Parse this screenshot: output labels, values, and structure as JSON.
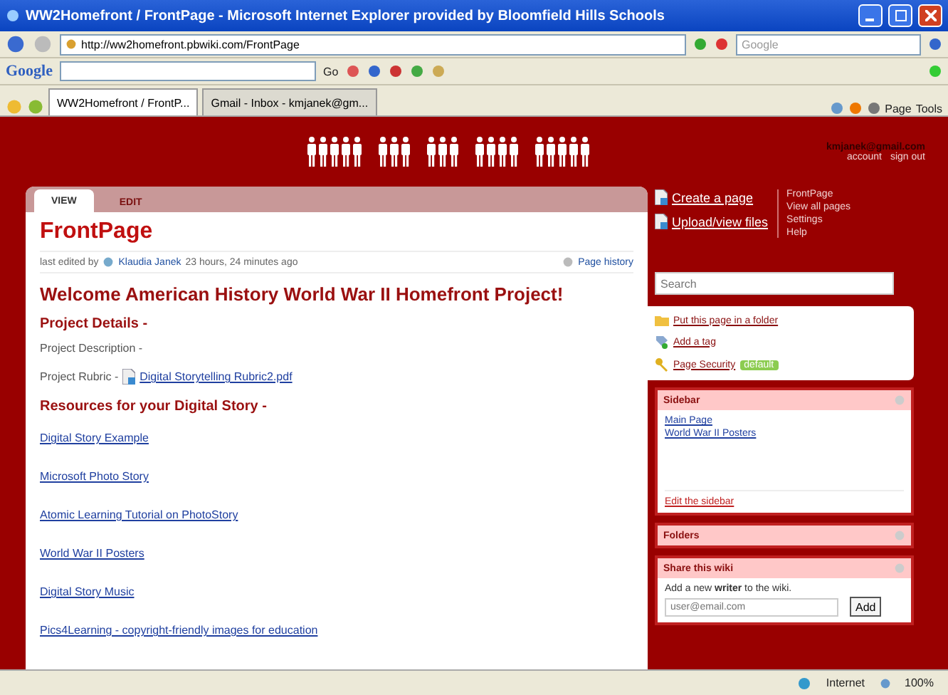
{
  "window": {
    "title": "WW2Homefront / FrontPage - Microsoft Internet Explorer provided by Bloomfield Hills Schools"
  },
  "address_bar": {
    "url": "http://ww2homefront.pbwiki.com/FrontPage",
    "search_placeholder": "Google"
  },
  "google_toolbar": {
    "logo": "Google",
    "go": "Go"
  },
  "browser_tabs": [
    {
      "label": "WW2Homefront / FrontP...",
      "selected": true
    },
    {
      "label": "Gmail - Inbox - kmjanek@gm...",
      "selected": false
    }
  ],
  "command_bar": {
    "page": "Page",
    "tools": "Tools"
  },
  "account": {
    "email": "kmjanek@gmail.com",
    "links": [
      "account",
      "sign out"
    ]
  },
  "page_tabs": [
    {
      "label": "VIEW",
      "selected": true
    },
    {
      "label": "EDIT",
      "selected": false
    }
  ],
  "page": {
    "title": "FrontPage",
    "last_edited_prefix": "last edited by",
    "author": "Klaudia Janek",
    "time": "23 hours, 24 minutes ago",
    "history": "Page history",
    "heading": "Welcome American History World War II Homefront Project!",
    "items": [
      {
        "kind": "heading",
        "text": "Project Details -"
      },
      {
        "kind": "text",
        "text": "Project Description -"
      },
      {
        "kind": "file",
        "text": "Project Rubric -",
        "link": "Digital Storytelling Rubric2.pdf"
      },
      {
        "kind": "heading",
        "text": "Resources for your Digital Story -"
      },
      {
        "kind": "link",
        "text": "Digital Story Example"
      },
      {
        "kind": "link",
        "text": "Microsoft Photo Story"
      },
      {
        "kind": "link",
        "text": "Atomic Learning Tutorial on PhotoStory"
      },
      {
        "kind": "link",
        "text": "World War II Posters"
      },
      {
        "kind": "link",
        "text": "Digital Story Music"
      },
      {
        "kind": "link",
        "text": "Pics4Learning - copyright-friendly images for education"
      }
    ]
  },
  "sidebar": {
    "actions": [
      "Create a page",
      "Upload/view files"
    ],
    "nav": [
      "FrontPage",
      "View all pages",
      "Settings",
      "Help"
    ],
    "search_placeholder": "Search",
    "page_tools": [
      {
        "kind": "folder",
        "text": "Put this page in a folder"
      },
      {
        "kind": "tag",
        "text": "Add a tag"
      },
      {
        "kind": "security",
        "text": "Page Security",
        "badge": "default"
      }
    ],
    "panels": [
      {
        "title": "Sidebar",
        "links": [
          "Main Page",
          "World War II Posters"
        ],
        "edit": "Edit the sidebar"
      },
      {
        "title": "Folders"
      },
      {
        "title": "Share this wiki",
        "text": "Add a new **writer** to the wiki.",
        "placeholder": "user@email.com",
        "button": "Add"
      }
    ]
  },
  "status_bar": {
    "zone": "Internet",
    "zoom": "100%"
  }
}
